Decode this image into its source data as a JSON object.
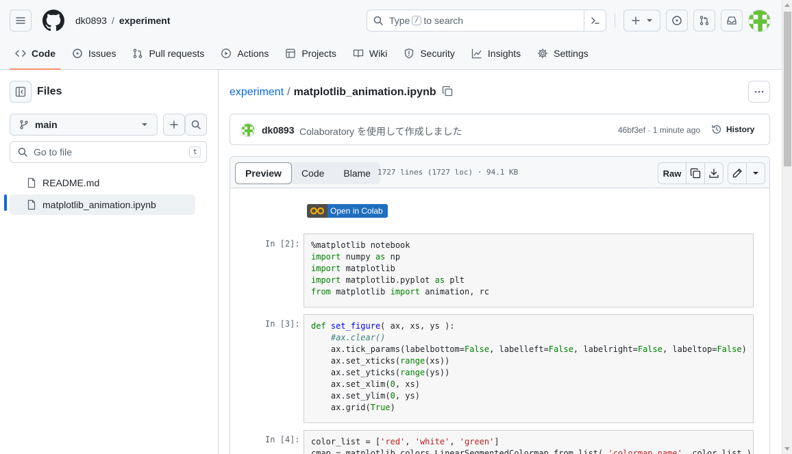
{
  "header": {
    "owner": "dk0893",
    "separator": "/",
    "repo": "experiment",
    "search": {
      "prefix": "Type",
      "key": "/",
      "suffix": "to search"
    }
  },
  "nav": [
    {
      "label": "Code",
      "icon": "code-icon"
    },
    {
      "label": "Issues",
      "icon": "issue-icon"
    },
    {
      "label": "Pull requests",
      "icon": "pull-request-icon"
    },
    {
      "label": "Actions",
      "icon": "play-icon"
    },
    {
      "label": "Projects",
      "icon": "table-icon"
    },
    {
      "label": "Wiki",
      "icon": "book-icon"
    },
    {
      "label": "Security",
      "icon": "shield-icon"
    },
    {
      "label": "Insights",
      "icon": "graph-icon"
    },
    {
      "label": "Settings",
      "icon": "gear-icon"
    }
  ],
  "sidebar": {
    "title": "Files",
    "branch": "main",
    "go_to_file": "Go to file",
    "go_to_file_key": "t",
    "files": [
      {
        "name": "README.md"
      },
      {
        "name": "matplotlib_animation.ipynb"
      }
    ]
  },
  "main": {
    "path_repo": "experiment",
    "path_sep": "/",
    "path_file": "matplotlib_animation.ipynb",
    "commit": {
      "author": "dk0893",
      "message": "Colaboratory を使用して作成しました",
      "meta": "46bf3ef · 1 minute ago",
      "history": "History"
    },
    "tabs": [
      "Preview",
      "Code",
      "Blame"
    ],
    "file_info": "1727 lines (1727 loc) · 94.1 KB",
    "raw_label": "Raw",
    "colab_badge": "Open in Colab",
    "prompts": [
      "In [2]:",
      "In [3]:",
      "In [4]:"
    ]
  },
  "colors": {
    "accent": "#0969da",
    "active_tab_underline": "#fd8c73",
    "colab_blue": "#1f6fbf"
  }
}
